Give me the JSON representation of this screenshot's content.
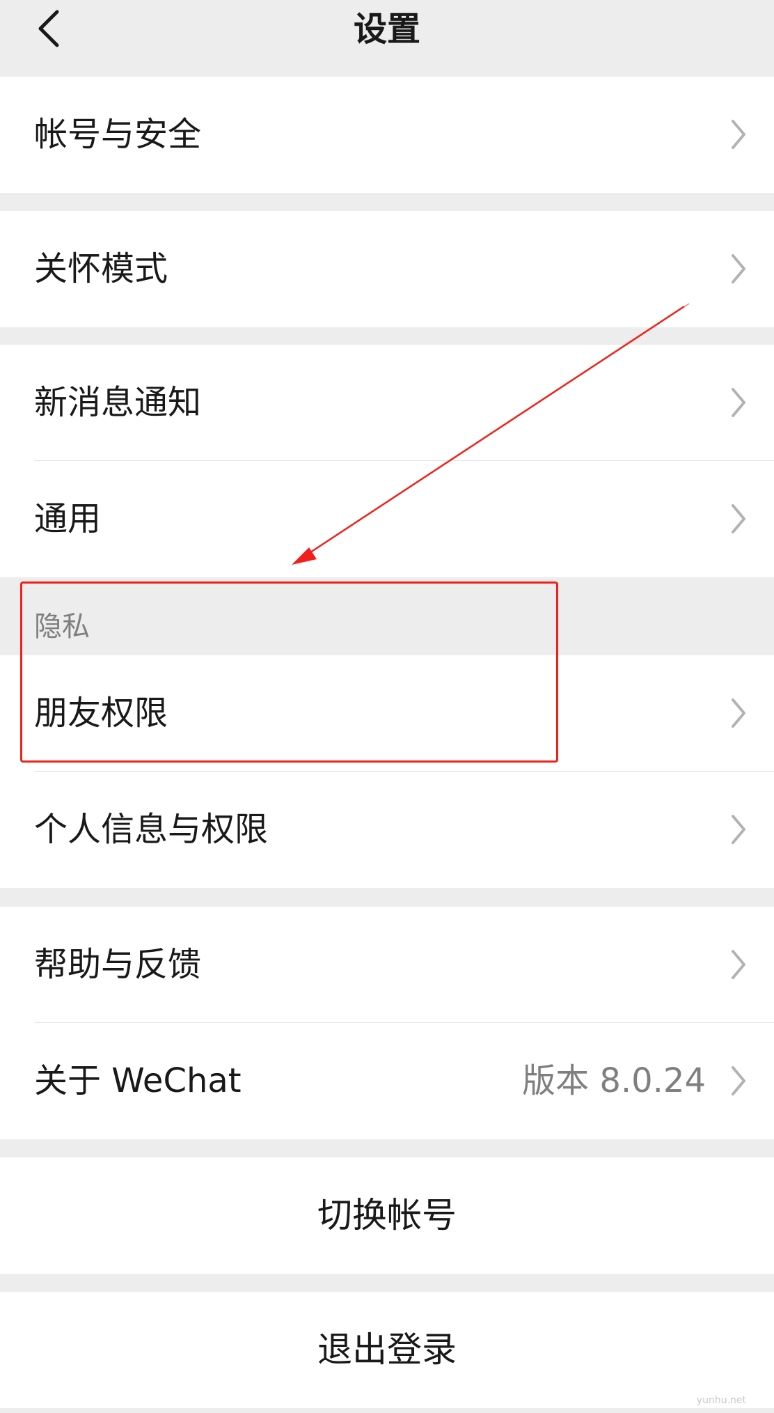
{
  "header": {
    "title": "设置"
  },
  "rows": {
    "account_security": "帐号与安全",
    "care_mode": "关怀模式",
    "notifications": "新消息通知",
    "general": "通用",
    "privacy_header": "隐私",
    "friend_permissions": "朋友权限",
    "personal_info": "个人信息与权限",
    "help_feedback": "帮助与反馈",
    "about_label": "关于 WeChat",
    "about_version": "版本 8.0.24"
  },
  "actions": {
    "switch_account": "切换帐号",
    "logout": "退出登录"
  },
  "watermark": "yunhu.net",
  "colors": {
    "background": "#ededed",
    "cell": "#ffffff",
    "annotation": "#f2201b",
    "secondary_text": "#7f7f7f"
  },
  "icons": {
    "back": "chevron-left-icon",
    "row_arrow": "chevron-right-icon"
  }
}
